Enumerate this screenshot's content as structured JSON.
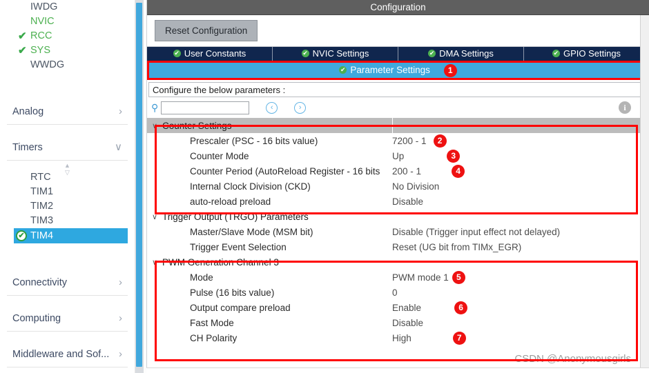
{
  "sidebar": {
    "peripherals": [
      {
        "label": "IWDG",
        "checked": false,
        "green": false
      },
      {
        "label": "NVIC",
        "checked": false,
        "green": true
      },
      {
        "label": "RCC",
        "checked": true,
        "green": true
      },
      {
        "label": "SYS",
        "checked": true,
        "green": true
      },
      {
        "label": "WWDG",
        "checked": false,
        "green": false
      }
    ],
    "groups": [
      {
        "label": "Analog",
        "arrow": "›"
      },
      {
        "label": "Timers",
        "arrow": "∨"
      }
    ],
    "timers": [
      {
        "label": "RTC",
        "selected": false
      },
      {
        "label": "TIM1",
        "selected": false
      },
      {
        "label": "TIM2",
        "selected": false
      },
      {
        "label": "TIM3",
        "selected": false
      },
      {
        "label": "TIM4",
        "selected": true
      }
    ],
    "bottom_groups": [
      {
        "label": "Connectivity",
        "arrow": "›"
      },
      {
        "label": "Computing",
        "arrow": "›"
      },
      {
        "label": "Middleware and Sof...",
        "arrow": "›"
      }
    ],
    "check_glyph": "✔",
    "tick_glyph": "✔"
  },
  "main": {
    "title": "Configuration",
    "reset_button": "Reset Configuration",
    "tabs": [
      {
        "label": "User Constants",
        "check": "✔"
      },
      {
        "label": "NVIC Settings",
        "check": "✔"
      },
      {
        "label": "DMA Settings",
        "check": "✔"
      },
      {
        "label": "GPIO Settings",
        "check": "✔"
      }
    ],
    "selected_tab": {
      "label": "Parameter Settings",
      "check": "✔",
      "badge": "1"
    },
    "configure_hint": "Configure the below parameters :",
    "search": {
      "value": "",
      "placeholder": "",
      "icon": "⚲"
    },
    "nav_prev_icon": "‹",
    "nav_next_icon": "›",
    "info_icon": "i",
    "caret_glyph": "∨"
  },
  "sections": [
    {
      "name": "Counter Settings",
      "shaded": true,
      "rows": [
        {
          "label": "Prescaler (PSC - 16 bits value)",
          "value": "7200 - 1",
          "badge": "2"
        },
        {
          "label": "Counter Mode",
          "value": "Up",
          "badge": "3"
        },
        {
          "label": "Counter Period (AutoReload Register - 16 bits ",
          "value": "200 - 1",
          "badge": "4"
        },
        {
          "label": "Internal Clock Division (CKD)",
          "value": "No Division",
          "badge": ""
        },
        {
          "label": "auto-reload preload",
          "value": "Disable",
          "badge": ""
        }
      ]
    },
    {
      "name": "Trigger Output (TRGO) Parameters",
      "shaded": false,
      "rows": [
        {
          "label": "Master/Slave Mode (MSM bit)",
          "value": "Disable (Trigger input effect not delayed)",
          "badge": ""
        },
        {
          "label": "Trigger Event Selection",
          "value": "Reset (UG bit from TIMx_EGR)",
          "badge": ""
        }
      ]
    },
    {
      "name": "PWM Generation Channel 3",
      "shaded": false,
      "rows": [
        {
          "label": "Mode",
          "value": "PWM mode 1",
          "badge": "5"
        },
        {
          "label": "Pulse (16 bits value)",
          "value": "0",
          "badge": ""
        },
        {
          "label": "Output compare preload",
          "value": "Enable",
          "badge": "6"
        },
        {
          "label": "Fast Mode",
          "value": "Disable",
          "badge": ""
        },
        {
          "label": "CH Polarity",
          "value": "High",
          "badge": "7"
        }
      ]
    }
  ],
  "watermark": "CSDN @Anonymousgirls",
  "colors": {
    "accent_blue": "#3fa9dd",
    "tab_navy": "#10264e",
    "annotation_red": "#ff0000",
    "check_green": "#4cb050",
    "title_gray": "#5f5f5f"
  }
}
